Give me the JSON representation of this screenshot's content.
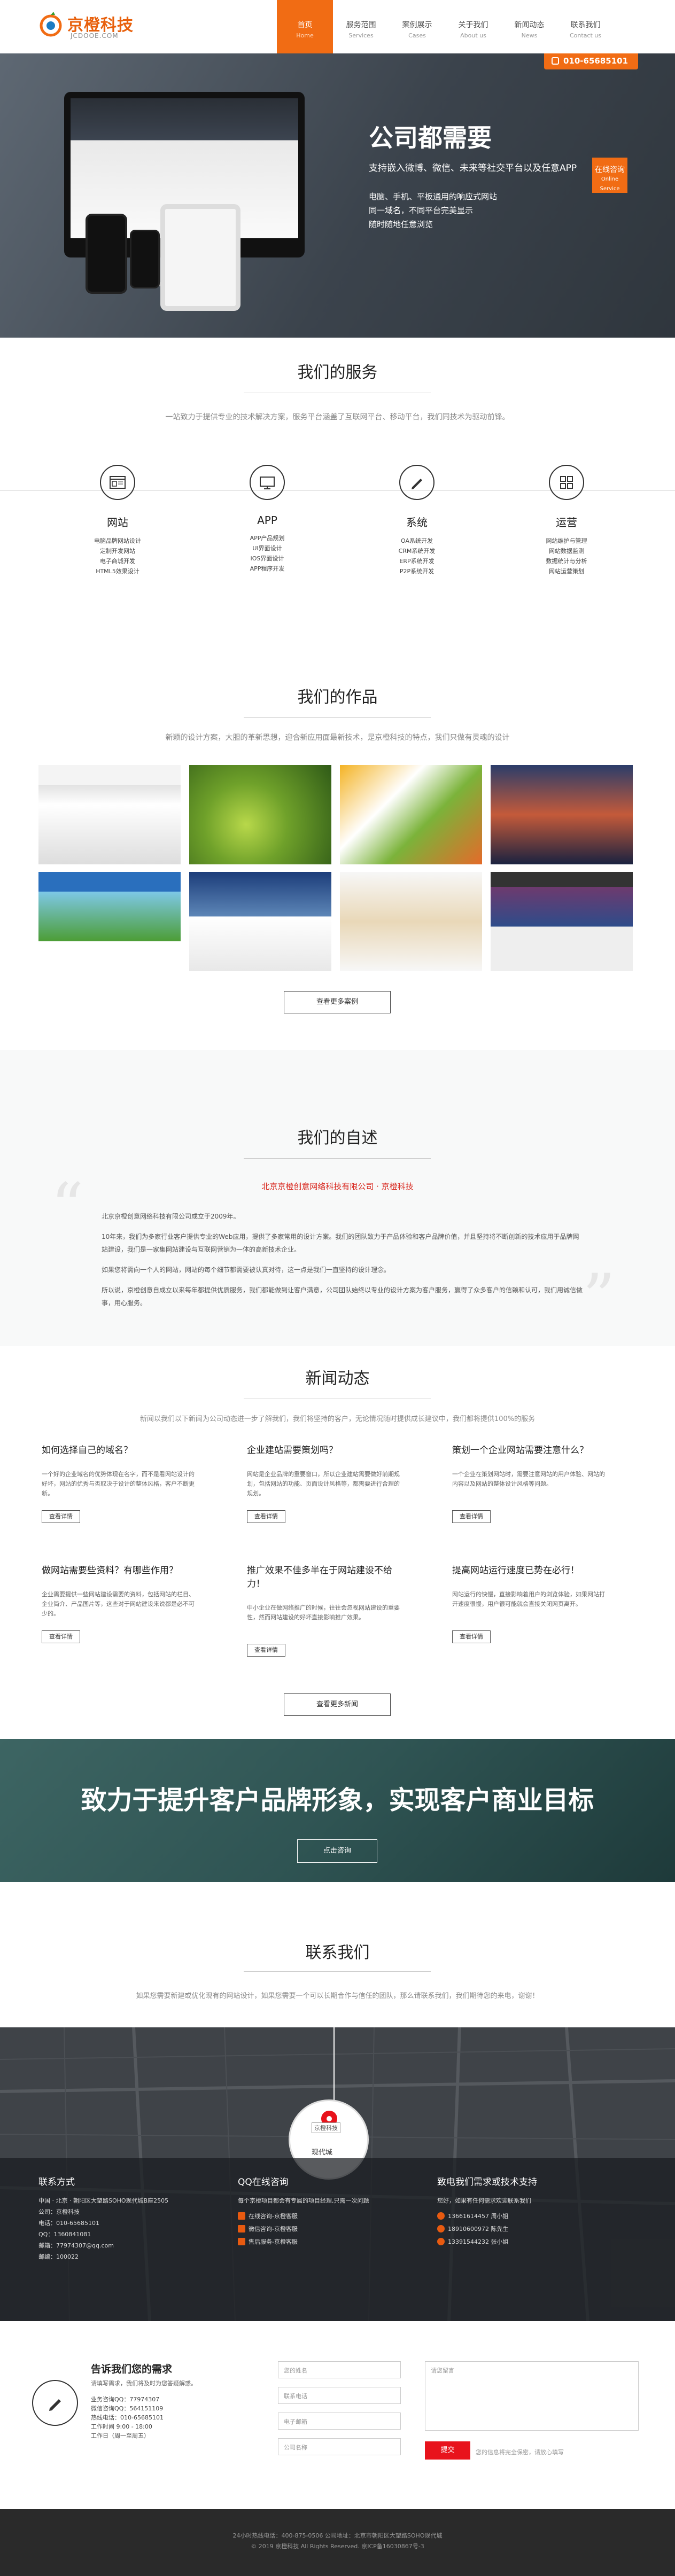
{
  "header": {
    "logo_title": "京橙科技",
    "logo_sub": "JCDOOE.COM",
    "nav": [
      {
        "zh": "首页",
        "en": "Home"
      },
      {
        "zh": "服务范围",
        "en": "Services"
      },
      {
        "zh": "案例展示",
        "en": "Cases"
      },
      {
        "zh": "关于我们",
        "en": "About us"
      },
      {
        "zh": "新闻动态",
        "en": "News"
      },
      {
        "zh": "联系我们",
        "en": "Contact us"
      }
    ],
    "active_color": "#f16c14"
  },
  "hero": {
    "hotline": "010-65685101",
    "title": "公司都需要",
    "subtitle": "支持嵌入微博、微信、未来等社交平台以及任意APP",
    "lines": [
      "电脑、手机、平板通用的响应式网站",
      "同一域名，不同平台完美显示",
      "随时随地任意浏览"
    ],
    "online_badge": "在线咨询",
    "online_badge_en": "Online Service"
  },
  "services": {
    "title": "我们的服务",
    "desc": "一站致力于提供专业的技术解决方案，服务平台涵盖了互联网平台、移动平台，我们同技术为驱动前锋。",
    "items": [
      {
        "icon": "website-icon",
        "title": "网站",
        "list": [
          "电脑品牌网站设计",
          "定制开发网站",
          "电子商城开发",
          "HTML5效果设计"
        ]
      },
      {
        "icon": "app-icon",
        "title": "APP",
        "list": [
          "APP产品规划",
          "UI界面设计",
          "iOS界面设计",
          "APP程序开发"
        ]
      },
      {
        "icon": "system-icon",
        "title": "系统",
        "list": [
          "OA系统开发",
          "CRM系统开发",
          "ERP系统开发",
          "P2P系统开发"
        ]
      },
      {
        "icon": "operation-icon",
        "title": "运营",
        "list": [
          "网站维护与管理",
          "网站数据监测",
          "数据统计与分析",
          "网站运营策划"
        ]
      }
    ]
  },
  "works": {
    "title": "我们的作品",
    "desc": "新颖的设计方案，大胆的革新思想，迎合新应用面最新技术，是京橙科技的特点，我们只做有灵魂的设计",
    "more": "查看更多案例"
  },
  "about": {
    "title": "我们的自述",
    "company": "北京京橙创意网络科技有限公司 · 京橙科技",
    "paragraphs": [
      "北京京橙创意网络科技有限公司成立于2009年。",
      "10年来，我们为多家行业客户提供专业的Web应用，提供了多家常用的设计方案。我们的团队致力于产品体验和客户品牌价值，并且坚持将不断创新的技术应用于品牌网站建设，我们是一家集网站建设与互联网营销为一体的高新技术企业。",
      "如果您将需向一个人的网站，网站的每个细节都需要被认真对待，这一点是我们一直坚持的设计理念。",
      "所以说，京橙创意自成立以来每年都提供优质服务，我们都能做到让客户满意，公司团队始终以专业的设计方案为客户服务，赢得了众多客户的信赖和认可，我们用诚信做事，用心服务。"
    ]
  },
  "news": {
    "title": "新闻动态",
    "desc": "新闻以我们以下新闻为公司动态进一步了解我们，我们将坚持的客户，无论情况随时提供成长建议中，我们都将提供100%的服务",
    "items": [
      {
        "title": "如何选择自己的域名？",
        "body": "一个好的企业域名的优势体现在名字，而不是看网站设计的好坏，网站的优秀与否取决于设计的整体风格，客户不断更新。",
        "btn": "查看详情"
      },
      {
        "title": "企业建站需要策划吗？",
        "body": "网站是企业品牌的重要窗口，所以企业建站需要做好前期规划，包括网站的功能、页面设计风格等，都需要进行合理的规划。",
        "btn": "查看详情"
      },
      {
        "title": "策划一个企业网站需要注意什么？",
        "body": "一个企业在策划网站时，需要注意网站的用户体验、网站的内容以及网站的整体设计风格等问题。",
        "btn": "查看详情"
      },
      {
        "title": "做网站需要些资料？有哪些作用？",
        "body": "企业需要提供一些网站建设需要的资料，包括网站的栏目、企业简介、产品图片等，这些对于网站建设来说都是必不可少的。",
        "btn": "查看详情"
      },
      {
        "title": "推广效果不佳多半在于网站建设不给力！",
        "body": "中小企业在做网络推广的时候，往往会忽视网站建设的重要性，然而网站建设的好坏直接影响推广效果。",
        "btn": "查看详情"
      },
      {
        "title": "提高网站运行速度已势在必行！",
        "body": "网站运行的快慢，直接影响着用户的浏览体验，如果网站打开速度很慢，用户很可能就会直接关闭网页离开。",
        "btn": "查看详情"
      }
    ],
    "more": "查看更多新闻"
  },
  "banner": {
    "text": "致力于提升客户品牌形象，实现客户商业目标",
    "btn": "点击咨询"
  },
  "contact": {
    "title": "联系我们",
    "desc": "如果您需要新建或优化现有的网站设计，如果您需要一个可以长期合作与信任的团队，那么请联系我们，我们期待您的来电，谢谢！",
    "pin_label": "京橙科技",
    "map_label": "现代城",
    "col1_title": "联系方式",
    "col1_lines": [
      "中国 · 北京 · 朝阳区大望路SOHO现代城B座2505",
      "公司：京橙科技",
      "电话：010-65685101",
      "QQ：1360841081",
      "邮箱：77974307@qq.com",
      "邮编：100022"
    ],
    "col2_title": "QQ在线咨询",
    "col2_lines": [
      "每个京橙项目都会有专属的项目经理,只需一次问题",
      "在线咨询-京橙客服",
      "微信咨询-京橙客服",
      "售后服务-京橙客服"
    ],
    "col3_title": "致电我们需求或技术支持",
    "col3_lines": [
      "您好，如果有任何需求欢迎联系我们",
      "13661614457 周小姐",
      "18910600972 陈先生",
      "13391544232 张小姐"
    ]
  },
  "form": {
    "title": "告诉我们您的需求",
    "sub": "请填写需求，我们将及时为您答疑解惑。",
    "info": [
      "业务咨询QQ：77974307",
      "微信咨询QQ：564151109",
      "热线电话：010-65685101",
      "工作时间 9:00 - 18:00",
      "工作日（周一至周五）"
    ],
    "name_ph": "您的姓名",
    "phone_ph": "联系电话",
    "email_ph": "电子邮箱",
    "company_ph": "公司名称",
    "message_ph": "请您留言",
    "submit": "提交",
    "note": "您的信息将完全保密，请放心填写"
  },
  "footer": {
    "line1": "24小时热线电话：400-875-0506 公司地址：北京市朝阳区大望路SOHO现代城",
    "line2": "© 2019 京橙科技 All Rights Reserved. 京ICP备16030867号-3"
  }
}
